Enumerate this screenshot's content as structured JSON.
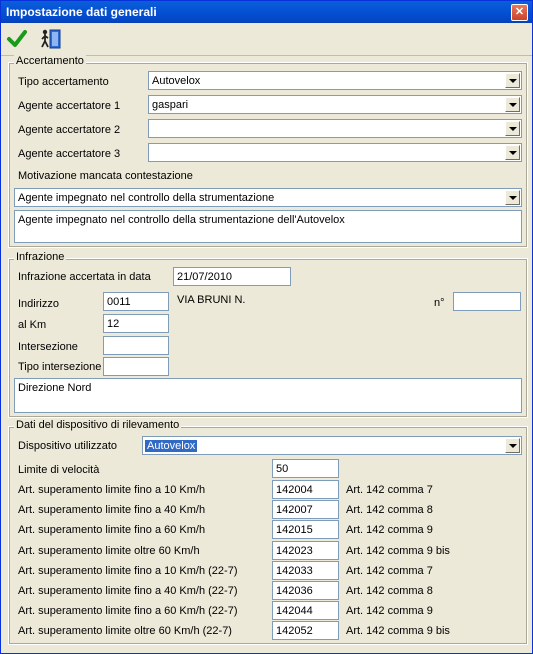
{
  "window": {
    "title": "Impostazione dati generali",
    "close_glyph": "✕"
  },
  "toolbar": {
    "ok_icon": "checkmark-icon",
    "exit_icon": "exit-door-icon"
  },
  "accertamento": {
    "legend": "Accertamento",
    "tipo_label": "Tipo accertamento",
    "tipo_value": "Autovelox",
    "agente1_label": "Agente accertatore 1",
    "agente1_value": "gaspari",
    "agente2_label": "Agente accertatore 2",
    "agente2_value": "",
    "agente3_label": "Agente accertatore 3",
    "agente3_value": "",
    "motivazione_label": "Motivazione mancata contestazione",
    "motivazione_value": "Agente impegnato nel controllo della strumentazione",
    "motivazione_text": "Agente impegnato nel controllo della strumentazione dell'Autovelox"
  },
  "infrazione": {
    "legend": "Infrazione",
    "data_label": "Infrazione accertata in data",
    "data_value": "21/07/2010",
    "indirizzo_label": "Indirizzo",
    "indirizzo_code": "0011",
    "indirizzo_name": "VIA BRUNI N.",
    "civico_label": "n°",
    "civico_value": "",
    "km_label": "al Km",
    "km_value": "12",
    "intersezione_label": "Intersezione",
    "intersezione_value": "",
    "tipo_intersezione_label": "Tipo intersezione",
    "tipo_intersezione_value": "",
    "note": "Direzione Nord"
  },
  "dispositivo": {
    "legend": "Dati del dispositivo di rilevamento",
    "dispositivo_label": "Dispositivo utilizzato",
    "dispositivo_value": "Autovelox",
    "limite_label": "Limite di velocità",
    "limite_value": "50",
    "articoli": [
      {
        "label": "Art. superamento limite fino a 10 Km/h",
        "code": "142004",
        "desc": "Art. 142 comma 7"
      },
      {
        "label": "Art. superamento limite fino a 40 Km/h",
        "code": "142007",
        "desc": "Art. 142 comma 8"
      },
      {
        "label": "Art. superamento limite fino a 60 Km/h",
        "code": "142015",
        "desc": "Art. 142 comma 9"
      },
      {
        "label": "Art. superamento limite oltre 60 Km/h",
        "code": "142023",
        "desc": "Art. 142 comma 9 bis"
      },
      {
        "label": "Art. superamento limite fino a 10 Km/h (22-7)",
        "code": "142033",
        "desc": "Art. 142 comma 7"
      },
      {
        "label": "Art. superamento limite fino a 40 Km/h (22-7)",
        "code": "142036",
        "desc": "Art. 142 comma 8"
      },
      {
        "label": "Art. superamento limite fino a 60 Km/h (22-7)",
        "code": "142044",
        "desc": "Art. 142 comma 9"
      },
      {
        "label": "Art. superamento limite oltre 60 Km/h (22-7)",
        "code": "142052",
        "desc": "Art. 142 comma 9 bis"
      }
    ]
  }
}
